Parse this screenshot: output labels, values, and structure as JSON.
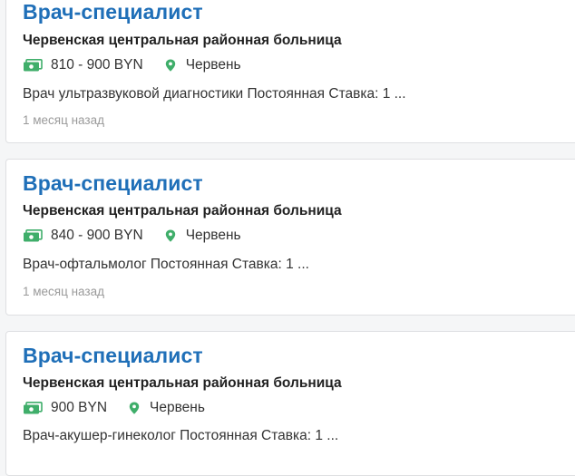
{
  "colors": {
    "title": "#1f6fb8",
    "icon_green": "#3fae6a",
    "muted_text": "#9a9a9a"
  },
  "icons": {
    "salary": "money-icon",
    "location": "map-pin-icon"
  },
  "jobs": [
    {
      "title": "Врач-специалист",
      "company": "Червенская центральная районная больница",
      "salary": "810 - 900 BYN",
      "location": "Червень",
      "description": "Врач ультразвуковой диагностики Постоянная Ставка: 1 ...",
      "posted": "1 месяц назад"
    },
    {
      "title": "Врач-специалист",
      "company": "Червенская центральная районная больница",
      "salary": "840 - 900 BYN",
      "location": "Червень",
      "description": "Врач-офтальмолог Постоянная Ставка: 1 ...",
      "posted": "1 месяц назад"
    },
    {
      "title": "Врач-специалист",
      "company": "Червенская центральная районная больница",
      "salary": "900 BYN",
      "location": "Червень",
      "description": "Врач-акушер-гинеколог Постоянная Ставка: 1 ..."
    }
  ]
}
